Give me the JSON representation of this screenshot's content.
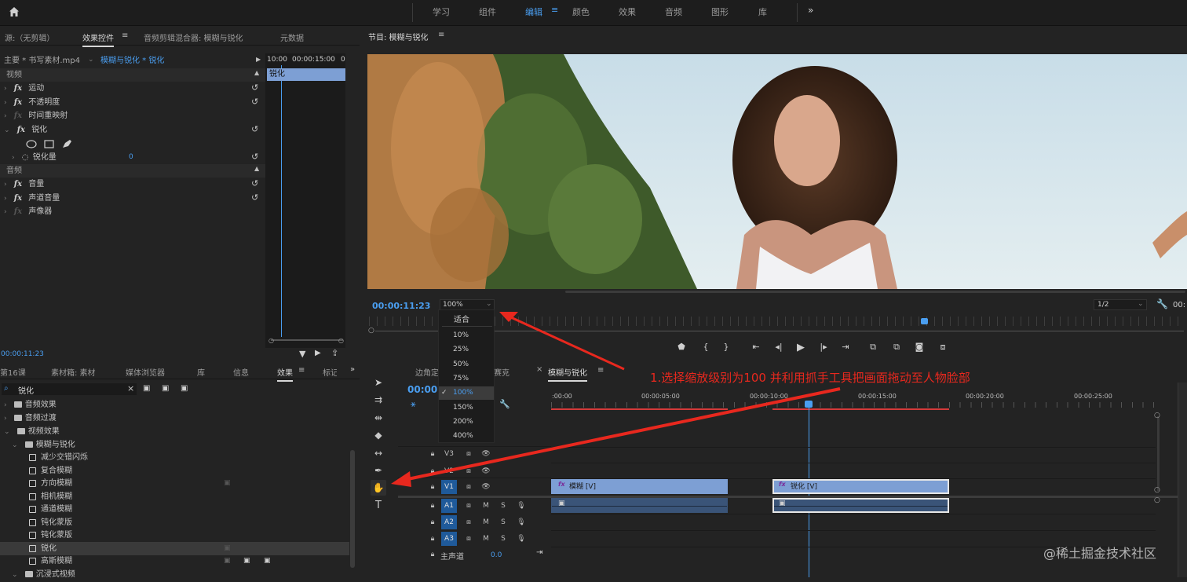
{
  "topbar": {
    "workspaces": [
      "学习",
      "组件",
      "编辑",
      "颜色",
      "效果",
      "音频",
      "图形",
      "库"
    ],
    "active": "编辑",
    "more": "»"
  },
  "effect_controls": {
    "tabs": [
      "源:（无剪辑）",
      "效果控件",
      "音频剪辑混合器: 模糊与锐化",
      "元数据"
    ],
    "master_clip": "主要 * 书写素材.mp4",
    "sequence_clip": "模糊与锐化 * 锐化",
    "time_a": "10:00",
    "time_b": "00:00:15:00",
    "time_c": "0",
    "mini_clip_label": "锐化",
    "video_header": "视频",
    "video_items": [
      "运动",
      "不透明度",
      "时间重映射",
      "锐化"
    ],
    "sharpen_amount_label": "锐化量",
    "sharpen_amount_value": "0",
    "audio_header": "音频",
    "audio_items": [
      "音量",
      "声道音量",
      "声像器"
    ],
    "timecode": "00:00:11:23"
  },
  "program": {
    "title": "节目: 模糊与锐化",
    "timecode": "00:00:11:23",
    "zoom_value": "100%",
    "resolution": "1/2",
    "right_time": "00:",
    "zoom_options": [
      "适合",
      "10%",
      "25%",
      "50%",
      "75%",
      "100%",
      "150%",
      "200%",
      "400%"
    ],
    "zoom_selected": "100%"
  },
  "project": {
    "tabs": [
      "第16课",
      "素材箱: 素材",
      "媒体浏览器",
      "库",
      "信息",
      "效果",
      "标记"
    ],
    "search_value": "锐化",
    "tree": [
      {
        "label": "音频效果",
        "level": 0
      },
      {
        "label": "音频过渡",
        "level": 0
      },
      {
        "label": "视频效果",
        "level": 0
      },
      {
        "label": "模糊与锐化",
        "level": 1
      },
      {
        "label": "减少交错闪烁",
        "level": 2
      },
      {
        "label": "复合模糊",
        "level": 2
      },
      {
        "label": "方向模糊",
        "level": 2
      },
      {
        "label": "相机模糊",
        "level": 2
      },
      {
        "label": "通道模糊",
        "level": 2
      },
      {
        "label": "钝化蒙版",
        "level": 2
      },
      {
        "label": "钝化蒙版",
        "level": 2
      },
      {
        "label": "锐化",
        "level": 2
      },
      {
        "label": "高斯模糊",
        "level": 2
      },
      {
        "label": "沉浸式视频",
        "level": 1
      }
    ]
  },
  "timeline": {
    "tabs": [
      "边角定",
      "赛克",
      "模糊与锐化"
    ],
    "timecode": "00:00",
    "ruler": [
      ":00:00",
      "00:00:05:00",
      "00:00:10:00",
      "00:00:15:00",
      "00:00:20:00",
      "00:00:25:00"
    ],
    "video_tracks": [
      "V3",
      "V2",
      "V1"
    ],
    "audio_tracks": [
      "A1",
      "A2",
      "A3"
    ],
    "mix_label": "主声道",
    "mix_value": "0.0",
    "clip1": "模糊 [V]",
    "clip2": "锐化 [V]",
    "track_m": "M",
    "track_s": "S"
  },
  "annotation": {
    "text": "1.选择缩放级别为100  并利用抓手工具把画面拖动至人物脸部",
    "color": "#e8281e"
  },
  "watermark": "@稀土掘金技术社区",
  "colors": {
    "accent": "#4a9ef0",
    "clip_video": "#7d9fd4",
    "clip_audio": "#3a5478",
    "track_active": "#1f5a9a"
  }
}
